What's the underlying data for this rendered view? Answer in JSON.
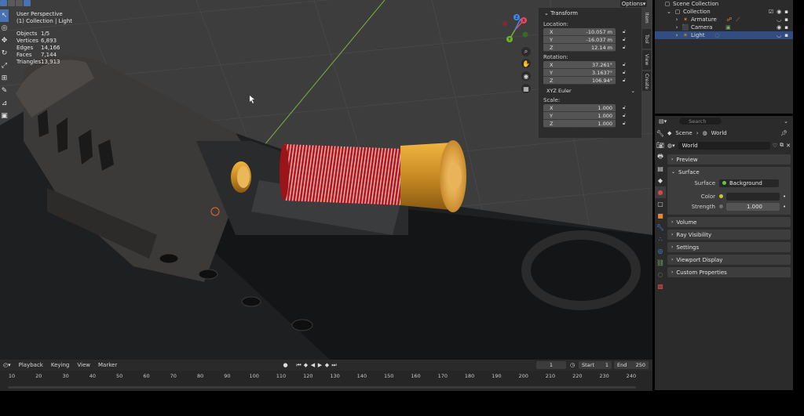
{
  "viewport": {
    "perspective": "User Perspective",
    "collection": "(1) Collection | Light",
    "stats": [
      {
        "label": "Objects",
        "value": "1/5"
      },
      {
        "label": "Vertices",
        "value": "6,893"
      },
      {
        "label": "Edges",
        "value": "14,166"
      },
      {
        "label": "Faces",
        "value": "7,144"
      },
      {
        "label": "Triangles",
        "value": "13,913"
      }
    ],
    "options_label": "Options",
    "gizmo": {
      "x": "X",
      "y": "Y",
      "z": "Z"
    }
  },
  "npanel": {
    "section": "Transform",
    "location_label": "Location:",
    "location": [
      {
        "axis": "X",
        "value": "-10.057 m"
      },
      {
        "axis": "Y",
        "value": "-16.037 m"
      },
      {
        "axis": "Z",
        "value": "12.14 m"
      }
    ],
    "rotation_label": "Rotation:",
    "rotation": [
      {
        "axis": "X",
        "value": "37.261°"
      },
      {
        "axis": "Y",
        "value": "3.1637°"
      },
      {
        "axis": "Z",
        "value": "106.94°"
      }
    ],
    "rotation_mode": "XYZ Euler",
    "scale_label": "Scale:",
    "scale": [
      {
        "axis": "X",
        "value": "1.000"
      },
      {
        "axis": "Y",
        "value": "1.000"
      },
      {
        "axis": "Z",
        "value": "1.000"
      }
    ],
    "tabs": [
      "Item",
      "Tool",
      "View",
      "Create"
    ]
  },
  "timeline": {
    "menus": [
      "Playback",
      "Keying",
      "View",
      "Marker"
    ],
    "current_frame": "1",
    "start_label": "Start",
    "start": "1",
    "end_label": "End",
    "end": "250",
    "ticks": [
      "10",
      "20",
      "30",
      "40",
      "50",
      "60",
      "70",
      "80",
      "90",
      "100",
      "110",
      "120",
      "130",
      "140",
      "150",
      "160",
      "170",
      "180",
      "190",
      "200",
      "210",
      "220",
      "230",
      "240"
    ]
  },
  "outliner": {
    "scene_collection": "Scene Collection",
    "collection": "Collection",
    "items": [
      "Armature",
      "Camera",
      "Light"
    ]
  },
  "properties": {
    "search_placeholder": "Search",
    "breadcrumb": [
      "Scene",
      "World"
    ],
    "world_name": "World",
    "panels": {
      "preview": "Preview",
      "surface": "Surface",
      "volume": "Volume",
      "ray_visibility": "Ray Visibility",
      "settings": "Settings",
      "viewport_display": "Viewport Display",
      "custom_properties": "Custom Properties"
    },
    "surface": {
      "surface_label": "Surface",
      "surface_value": "Background",
      "color_label": "Color",
      "strength_label": "Strength",
      "strength_value": "1.000"
    }
  },
  "colors": {
    "accent": "#4772b3",
    "selected_row": "#334d80",
    "shell_red": "#b0181c",
    "brass": "#c8922a",
    "grid_green": "#7fae3a"
  }
}
